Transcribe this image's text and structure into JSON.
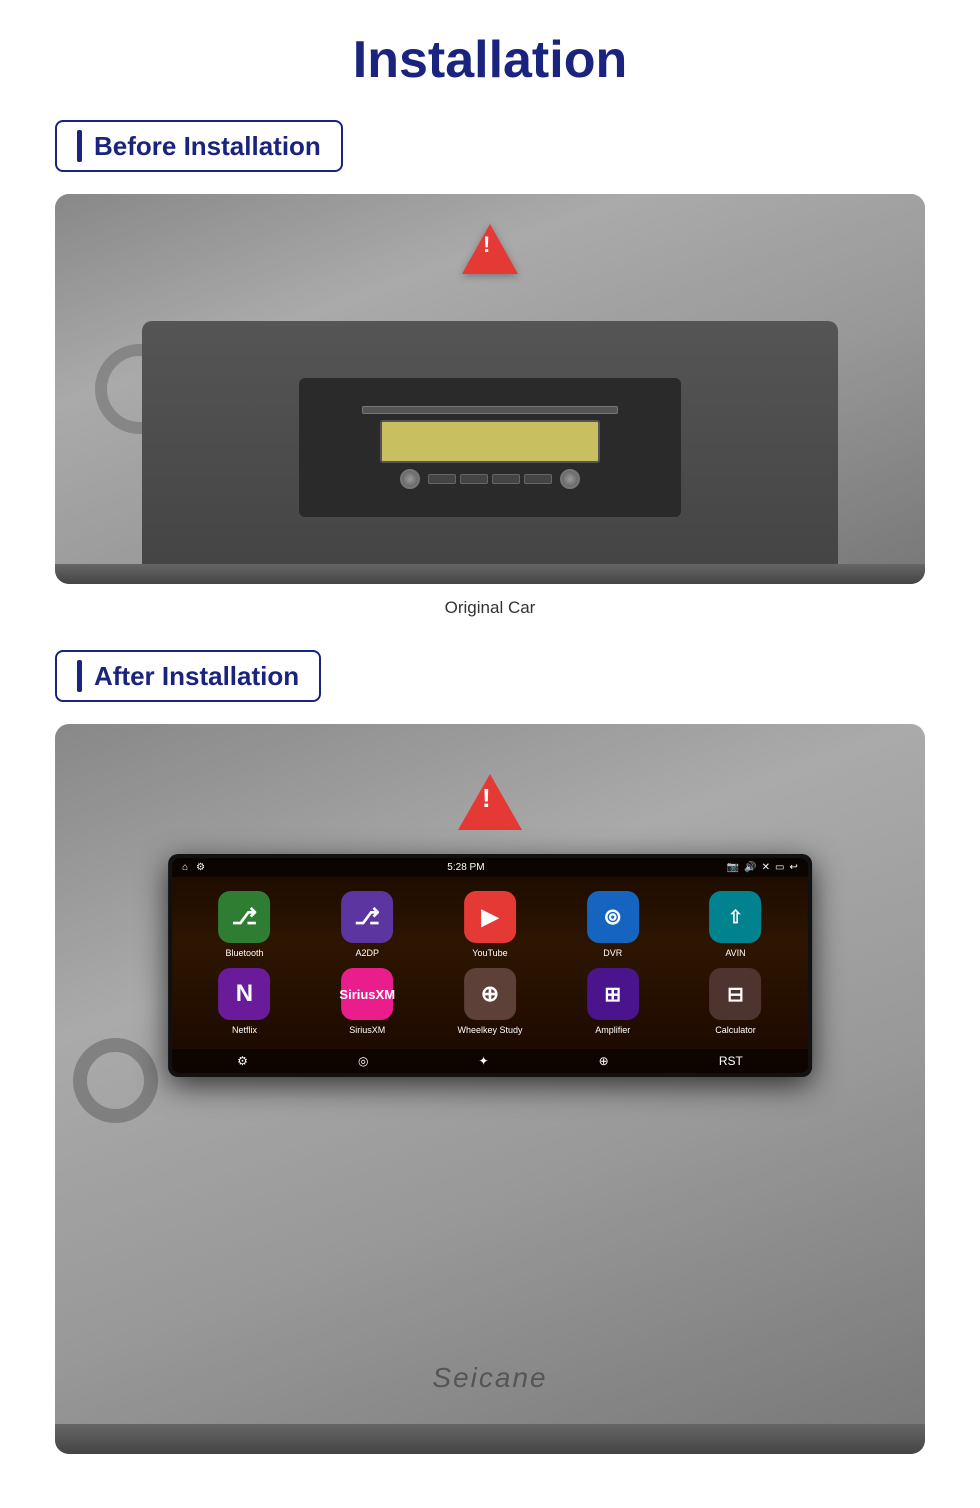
{
  "page": {
    "title": "Installation"
  },
  "sections": {
    "before": {
      "label": "Before Installation",
      "caption": "Original Car"
    },
    "after": {
      "label": "After Installation"
    }
  },
  "apps": [
    {
      "name": "Bluetooth",
      "class": "app-bluetooth",
      "symbol": "⌬",
      "row": 1
    },
    {
      "name": "A2DP",
      "class": "app-a2dp",
      "symbol": "⌬",
      "row": 1
    },
    {
      "name": "YouTube",
      "class": "app-youtube",
      "symbol": "▶",
      "row": 1
    },
    {
      "name": "DVR",
      "class": "app-dvr",
      "symbol": "◎",
      "row": 1
    },
    {
      "name": "AVIN",
      "class": "app-avin",
      "symbol": "⬆",
      "row": 1
    },
    {
      "name": "Netflix",
      "class": "app-netflix",
      "symbol": "N",
      "row": 2
    },
    {
      "name": "SiriusXM",
      "class": "app-siriusxm",
      "symbol": "S",
      "row": 2
    },
    {
      "name": "Wheelkey Study",
      "class": "app-wheelkey",
      "symbol": "⊕",
      "row": 2
    },
    {
      "name": "Amplifier",
      "class": "app-amplifier",
      "symbol": "⊞",
      "row": 2
    },
    {
      "name": "Calculator",
      "class": "app-calculator",
      "symbol": "⊟",
      "row": 2
    }
  ],
  "statusBar": {
    "time": "5:28 PM",
    "homeIcon": "⌂",
    "settingsIcon": "⚙"
  },
  "seicane": "Seicane",
  "colors": {
    "titleColor": "#1a237e",
    "badgeBorder": "#1a237e"
  }
}
